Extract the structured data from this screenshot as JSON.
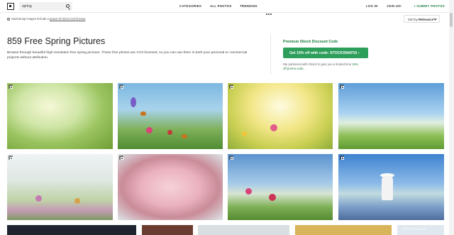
{
  "header": {
    "search_value": "spring",
    "nav": [
      "CATEGORIES",
      "ALL PHOTOS",
      "TRENDING"
    ],
    "more_icon": "dots-icon",
    "login": "LOG IN",
    "join": "JOIN US!",
    "submit": "+ SUBMIT PHOTOS"
  },
  "notice": {
    "prefix": "StockSnap images include a",
    "link": "peace-of-mind CC0 license"
  },
  "sort": {
    "label": "Sort by",
    "value": "Relevance"
  },
  "main": {
    "title": "859 Free Spring Pictures",
    "description": "Browse through beautiful high-resolution free spring pictures. These free photos are CC0 licensed, so you can use them in both your personal or commercial projects without attribution."
  },
  "promo": {
    "title": "Premium iStock Discount Code",
    "button": "Get 15% off with code: STOCKSNAP15 ›",
    "note_prefix": "We partnered with iStock to give you a limited time",
    "note_link": "15% off promo code."
  },
  "watermark": "@StockSnap.io",
  "colors": {
    "accent": "#2e9e5b",
    "accent_text": "#1a7c3e"
  }
}
